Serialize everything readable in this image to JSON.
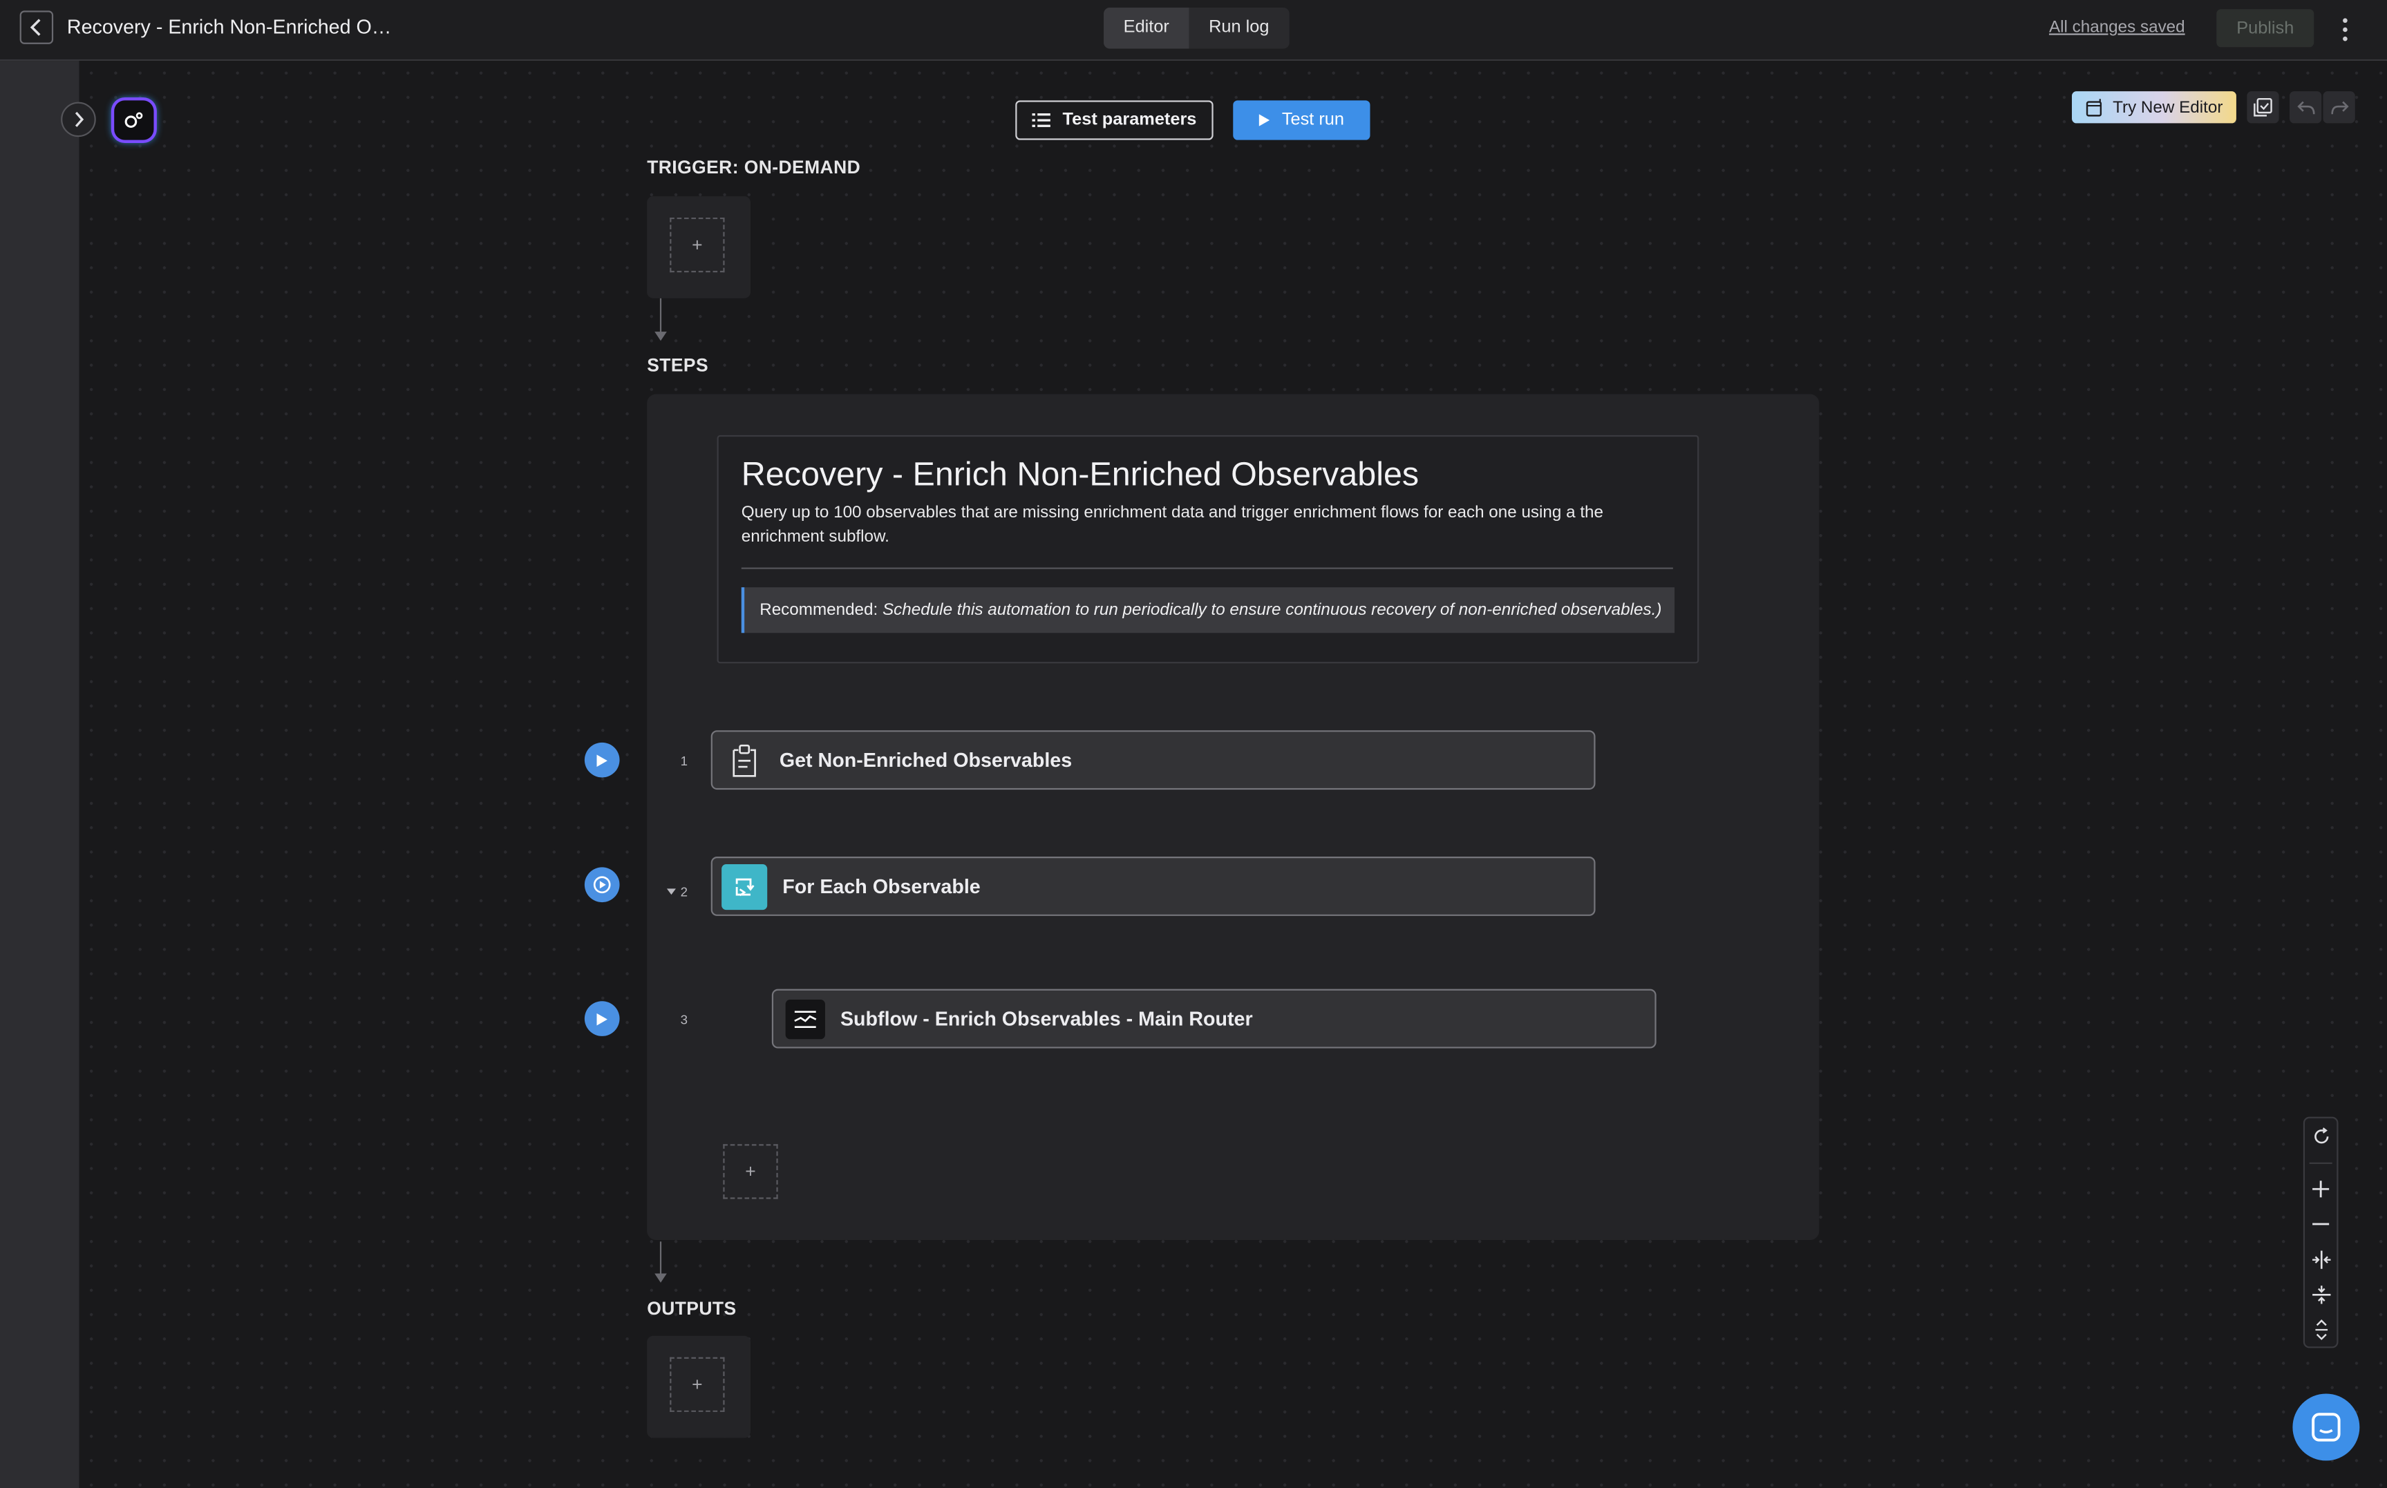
{
  "header": {
    "title": "Recovery - Enrich Non-Enriched Ob...",
    "tabs": [
      {
        "label": "Editor",
        "active": true
      },
      {
        "label": "Run log",
        "active": false
      }
    ],
    "save_status": "All changes saved",
    "publish_label": "Publish"
  },
  "toolbar": {
    "test_parameters_label": "Test parameters",
    "test_run_label": "Test run",
    "try_new_editor_label": "Try New Editor"
  },
  "canvas": {
    "trigger_label": "TRIGGER: ON-DEMAND",
    "steps_label": "STEPS",
    "outputs_label": "OUTPUTS",
    "add_symbol": "+",
    "note": {
      "title": "Recovery - Enrich Non-Enriched Observables",
      "description": "Query up to 100 observables that are missing enrichment data and trigger enrichment flows for each one using a the enrichment subflow.",
      "callout_label": "Recommended:",
      "callout_text": "Schedule this automation to run periodically to ensure continuous recovery of non-enriched observables.)"
    },
    "steps": [
      {
        "number": "1",
        "title": "Get Non-Enriched Observables",
        "icon": "query-document-icon"
      },
      {
        "number": "2",
        "title": "For Each Observable",
        "icon": "loop-icon",
        "collapsible": true
      },
      {
        "number": "3",
        "title": "Subflow - Enrich Observables - Main Router",
        "icon": "subflow-icon"
      }
    ]
  },
  "colors": {
    "accent": "#3d8fe8",
    "loop_icon_bg": "#3fb6c8",
    "callout_border": "#4a90e2"
  }
}
